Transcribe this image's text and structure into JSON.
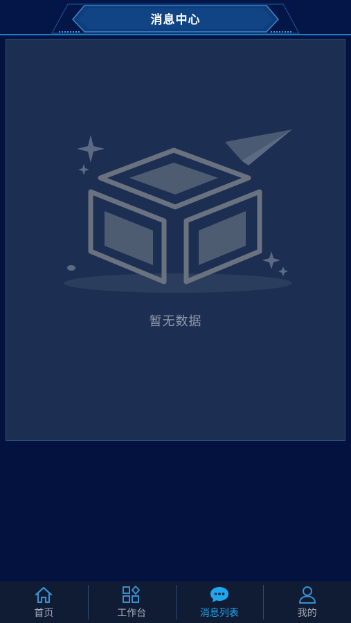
{
  "header": {
    "title": "消息中心"
  },
  "main": {
    "empty_state": {
      "text": "暂无数据",
      "icon": "empty-box-icon"
    }
  },
  "tabbar": {
    "active_tab": "消息列表",
    "tabs": [
      {
        "label": "首页",
        "icon": "home-icon"
      },
      {
        "label": "工作台",
        "icon": "grid-icon"
      },
      {
        "label": "消息列表",
        "icon": "chat-bubble-icon"
      },
      {
        "label": "我的",
        "icon": "user-icon"
      }
    ]
  },
  "colors": {
    "background": "#03123f",
    "panel": "#1c2f52",
    "accent": "#1ea6ef",
    "tab_inactive": "#a3abb9"
  }
}
